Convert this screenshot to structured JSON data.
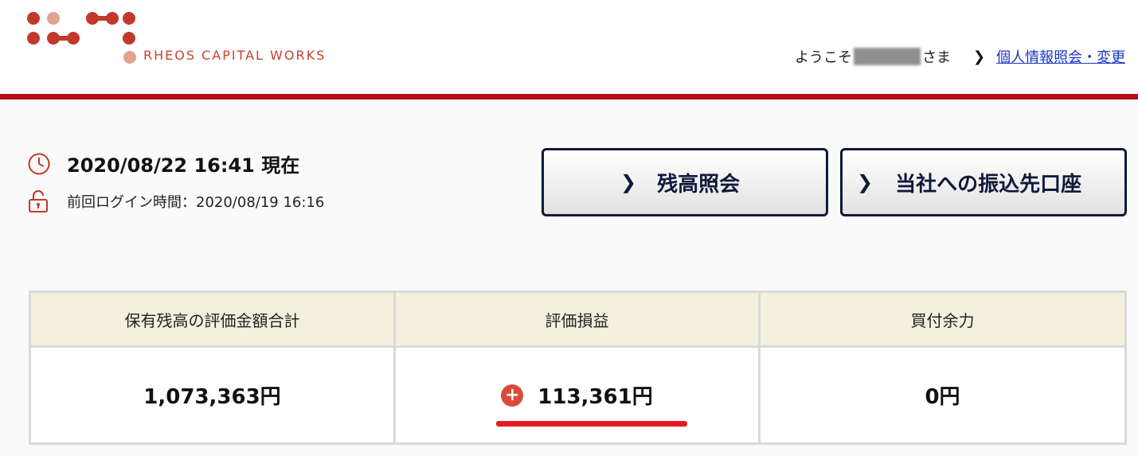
{
  "header": {
    "brand": "RHEOS CAPITAL WORKS",
    "welcome_prefix": "ようこそ",
    "welcome_suffix": "さま",
    "profile_link": "個人情報照会・変更"
  },
  "status": {
    "current_time": "2020/08/22 16:41 現在",
    "last_login": "前回ログイン時間：2020/08/19 16:16"
  },
  "buttons": {
    "balance": "残高照会",
    "transfer": "当社への振込先口座"
  },
  "summary": {
    "headers": [
      "保有残高の評価金額合計",
      "評価損益",
      "買付余力"
    ],
    "values": [
      "1,073,363円",
      "113,361円",
      "0円"
    ],
    "gain_sign": "+"
  },
  "colors": {
    "accent": "#b01018",
    "logo_dark": "#c0392b",
    "logo_light": "#e0a38f",
    "button_border": "#0f1a3a",
    "table_header_bg": "#f3f1de",
    "link": "#1a36c9",
    "highlight": "#e41c23"
  },
  "icons": [
    "clock-icon",
    "unlock-icon",
    "chevron-right-icon",
    "plus-icon"
  ]
}
